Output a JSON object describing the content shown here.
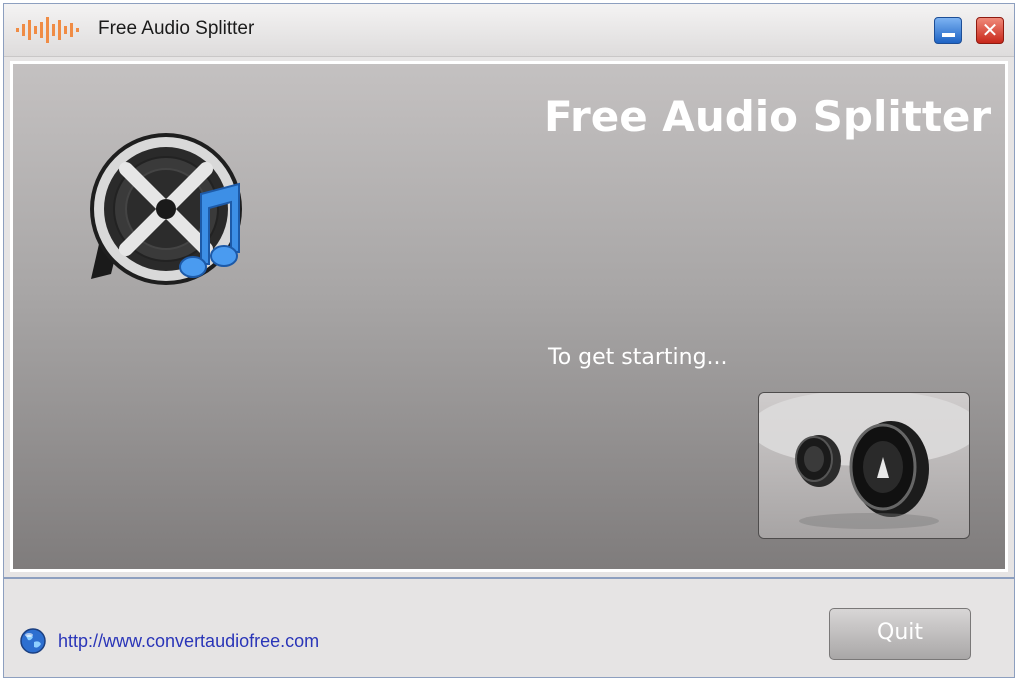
{
  "window": {
    "title": "Free Audio Splitter",
    "icons": {
      "logo": "audio-waveform-icon",
      "minimize": "minimize-icon",
      "close": "close-icon"
    },
    "close_symbol": "✕"
  },
  "main": {
    "heading": "Free Audio Splitter",
    "prompt": "To get starting...",
    "reel_icon": "film-reel-music-note-icon",
    "speaker_button_icon": "speakers-icon"
  },
  "footer": {
    "link_text": "http://www.convertaudiofree.com",
    "globe_icon": "globe-icon",
    "quit_label": "Quit"
  },
  "colors": {
    "panel_top": "#c4c1c1",
    "panel_bottom": "#7f7c7c",
    "link": "#2a35b8",
    "accent_orange": "#f08c45"
  }
}
